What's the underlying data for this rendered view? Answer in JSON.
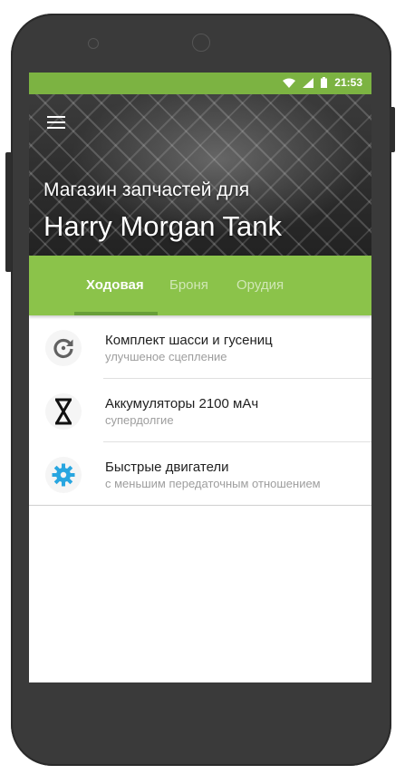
{
  "status_bar": {
    "time": "21:53",
    "icons": [
      "wifi-icon",
      "signal-icon",
      "battery-icon"
    ]
  },
  "header": {
    "menu_icon": "hamburger-menu-icon",
    "subtitle": "Магазин запчастей для",
    "title": "Harry Morgan Tank"
  },
  "tabs": [
    {
      "label": "Ходовая",
      "active": true
    },
    {
      "label": "Броня",
      "active": false
    },
    {
      "label": "Орудия",
      "active": false
    }
  ],
  "items": [
    {
      "icon": "refresh-icon",
      "title": "Комплект шасси и гусениц",
      "subtitle": "улучшеное сцепление"
    },
    {
      "icon": "hourglass-icon",
      "title": "Аккумуляторы 2100 мАч",
      "subtitle": "супердолгие"
    },
    {
      "icon": "gear-icon",
      "title": "Быстрые двигатели",
      "subtitle": "с меньшим передаточным отношением"
    }
  ],
  "colors": {
    "status_bar": "#7cb342",
    "tab_bar": "#8bc34a",
    "tab_indicator": "#689f38",
    "gear_icon": "#29a6e0"
  }
}
